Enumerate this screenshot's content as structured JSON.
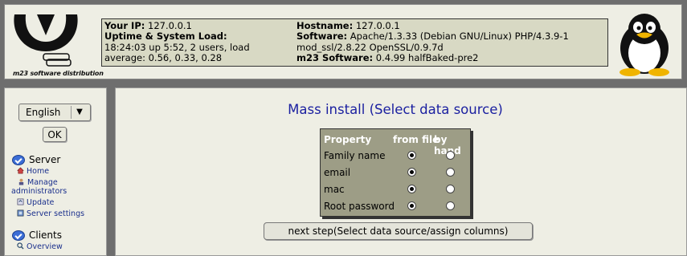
{
  "header": {
    "logo_text": "m23 software distribution",
    "your_ip_label": "Your IP:",
    "your_ip_value": "127.0.0.1",
    "uptime_label": "Uptime & System Load:",
    "uptime_value": "18:24:03 up 5:52, 2 users, load average: 0.56, 0.33, 0.28",
    "hostname_label": "Hostname:",
    "hostname_value": "127.0.0.1",
    "software_label": "Software:",
    "software_value": "Apache/1.3.33 (Debian GNU/Linux) PHP/4.3.9-1 mod_ssl/2.8.22 OpenSSL/0.9.7d",
    "m23_label": "m23 Software:",
    "m23_value": "0.4.99 halfBaked-pre2"
  },
  "sidebar": {
    "language_selected": "English",
    "ok_label": "OK",
    "sections": [
      {
        "title": "Server",
        "items": [
          {
            "label": "Home",
            "icon": "house-icon"
          },
          {
            "label": "Manage administrators",
            "icon": "admin-icon"
          },
          {
            "label": "Update",
            "icon": "update-icon"
          },
          {
            "label": "Server settings",
            "icon": "settings-icon"
          }
        ]
      },
      {
        "title": "Clients",
        "items": [
          {
            "label": "Overview",
            "icon": "magnifier-icon"
          }
        ]
      }
    ]
  },
  "main": {
    "title": "Mass install (Select data source)",
    "table": {
      "col_property": "Property",
      "col_from_file": "from file",
      "col_by_hand": "by hand",
      "rows": [
        {
          "label": "Family name",
          "selected": "from file"
        },
        {
          "label": "email",
          "selected": "from file"
        },
        {
          "label": "mac",
          "selected": "from file"
        },
        {
          "label": "Root password",
          "selected": "from file"
        }
      ]
    },
    "next_button": "next step(Select data source/assign columns)"
  },
  "colors": {
    "title": "#1a1fa0",
    "link": "#1a2f8c",
    "table_bg": "#9d9d86",
    "infobox_bg": "#d8d9c4"
  }
}
